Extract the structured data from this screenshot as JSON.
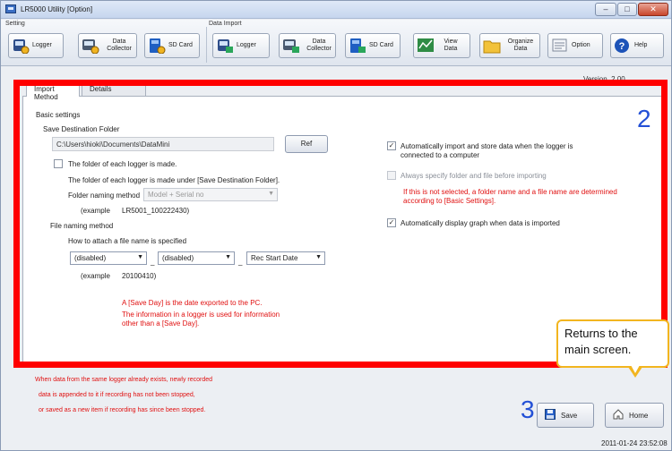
{
  "window": {
    "title": "LR5000 Utility [Option]"
  },
  "toolbar": {
    "setting_label": "Setting",
    "data_import_label": "Data Import",
    "setting_buttons": [
      {
        "label": "Logger",
        "icon": "logger-icon"
      },
      {
        "label": "Data Collector",
        "icon": "data-collector-icon"
      },
      {
        "label": "SD Card",
        "icon": "sd-card-icon"
      }
    ],
    "import_buttons": [
      {
        "label": "Logger",
        "icon": "logger-import-icon"
      },
      {
        "label": "Data Collector",
        "icon": "data-collector-import-icon"
      },
      {
        "label": "SD Card",
        "icon": "sd-card-import-icon"
      }
    ],
    "view_data": "View Data",
    "organize_data": "Organize Data",
    "option": "Option",
    "help": "Help"
  },
  "main": {
    "version_label": "Version",
    "version_value": "2.00",
    "tabs": [
      {
        "label": "Import Method",
        "active": true
      },
      {
        "label": "Details",
        "active": false
      }
    ]
  },
  "basic": {
    "heading": "Basic settings",
    "save_folder_label": "Save Destination Folder",
    "save_folder_value": "C:\\Users\\hioki\\Documents\\DataMini",
    "ref_button": "Ref",
    "folder_each_logger_label": "The folder of each logger is made.",
    "folder_made_under": "The folder of each logger is made under [Save Destination Folder].",
    "folder_naming_label": "Folder naming method",
    "folder_naming_value": "Model + Serial no",
    "folder_example_label": "(example",
    "folder_example_value": "LR5001_100222430)",
    "file_naming_heading": "File naming method",
    "file_naming_desc": "How to attach a file name is specified",
    "select1": "(disabled)",
    "select2": "(disabled)",
    "select3": "Rec Start Date",
    "file_example_label": "(example",
    "file_example_value": "20100410)",
    "note_line1": "A [Save Day] is the date exported to the PC.",
    "note_line2": "The information in a logger is used for information",
    "note_line3": "other than a [Save Day]."
  },
  "options": {
    "auto_import_line1": "Automatically import and store data when the logger is",
    "auto_import_line2": "connected to a computer",
    "always_specify": "Always specify folder and file before importing",
    "warn_line1": "If this is not selected, a folder name and a file name are determined",
    "warn_line2": "according to [Basic Settings].",
    "auto_display": "Automatically display graph when data is imported"
  },
  "markers": {
    "two": "2",
    "three": "3"
  },
  "bottom": {
    "note1": "When data from the same logger already exists, newly recorded",
    "note2": "data is appended to it if recording has not been stopped,",
    "note3": "or saved as a new item if recording has since been stopped.",
    "save_button": "Save",
    "home_button": "Home",
    "callout_line1": "Returns to the",
    "callout_line2": "main screen.",
    "timestamp": "2011-01-24 23:52:08"
  },
  "colors": {
    "highlight_frame": "#ff0000",
    "marker_blue": "#2350d6",
    "callout_border": "#f2b51f",
    "note_red": "#e01010"
  }
}
